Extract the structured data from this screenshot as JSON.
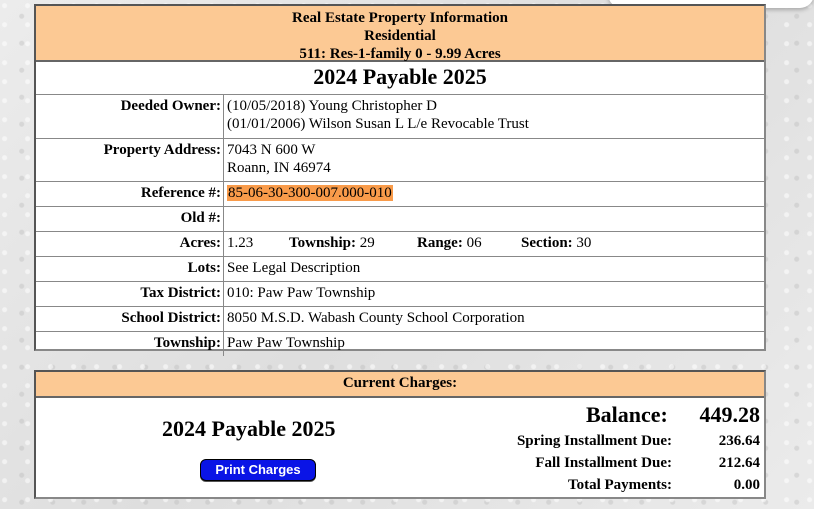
{
  "header": {
    "line1": "Real Estate Property Information",
    "line2": "Residential",
    "line3": "511: Res-1-family 0 - 9.99 Acres"
  },
  "year_title": "2024 Payable 2025",
  "fields": {
    "deeded_owner_label": "Deeded Owner:",
    "deeded_owner_1": "(10/05/2018) Young Christopher D",
    "deeded_owner_2": "(01/01/2006) Wilson Susan L L/e Revocable Trust",
    "address_label": "Property Address:",
    "address_1": "7043 N 600 W",
    "address_2": "Roann, IN 46974",
    "reference_label": "Reference #:",
    "reference_value": "85-06-30-300-007.000-010",
    "old_label": "Old #:",
    "old_value": "",
    "acres_label": "Acres:",
    "acres_value": "1.23",
    "township_inline_label": "Township:",
    "township_inline_value": "29",
    "range_label": "Range:",
    "range_value": "06",
    "section_label": "Section:",
    "section_value": "30",
    "lots_label": "Lots:",
    "lots_value": "See Legal Description",
    "tax_district_label": "Tax District:",
    "tax_district_value": "010: Paw Paw Township",
    "school_district_label": "School District:",
    "school_district_value": "8050 M.S.D. Wabash County School Corporation",
    "township_label": "Township:",
    "township_value": "Paw Paw Township"
  },
  "charges": {
    "header": "Current Charges:",
    "year_title": "2024 Payable 2025",
    "print_button": "Print Charges",
    "balance_label": "Balance:",
    "balance_value": "449.28",
    "spring_label": "Spring Installment Due:",
    "spring_value": "236.64",
    "fall_label": "Fall Installment Due:",
    "fall_value": "212.64",
    "total_label": "Total Payments:",
    "total_value": "0.00"
  },
  "colors": {
    "header_bg": "#fcc994",
    "highlight": "#f99b4a",
    "button_bg": "#0a14e6"
  }
}
